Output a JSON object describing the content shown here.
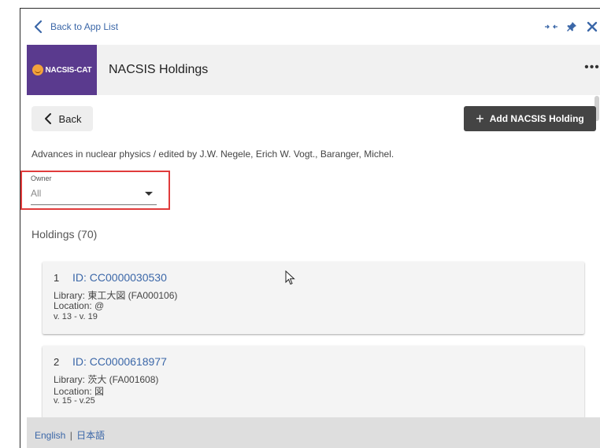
{
  "topbar": {
    "back_label": "Back to App List",
    "icons": [
      "collapse-arrows-icon",
      "pin-icon",
      "close-icon"
    ]
  },
  "header": {
    "logo_text": "NACSIS-CAT",
    "title": "NACSIS Holdings",
    "more_label": "•••"
  },
  "toolbar": {
    "back_label": "Back",
    "add_label": "Add NACSIS Holding"
  },
  "citation": "Advances in nuclear physics / edited by J.W. Negele, Erich W. Vogt., Baranger, Michel.",
  "owner": {
    "label": "Owner",
    "value": "All"
  },
  "holdings": {
    "title": "Holdings (70)",
    "items": [
      {
        "num": "1",
        "id": "ID: CC0000030530",
        "library": "Library: 東工大図 (FA000106)",
        "location": "Location: @",
        "volumes": "v. 13 - v. 19"
      },
      {
        "num": "2",
        "id": "ID: CC0000618977",
        "library": "Library: 茨大 (FA001608)",
        "location": "Location: 図",
        "volumes": "v. 15 - v.25"
      }
    ]
  },
  "footer": {
    "lang_en": "English",
    "separator": "|",
    "lang_ja": "日本語"
  },
  "colors": {
    "link": "#3b67a8",
    "logo_bg": "#5a3a8e",
    "primary_button": "#444444",
    "highlight_border": "#e03b3b"
  }
}
